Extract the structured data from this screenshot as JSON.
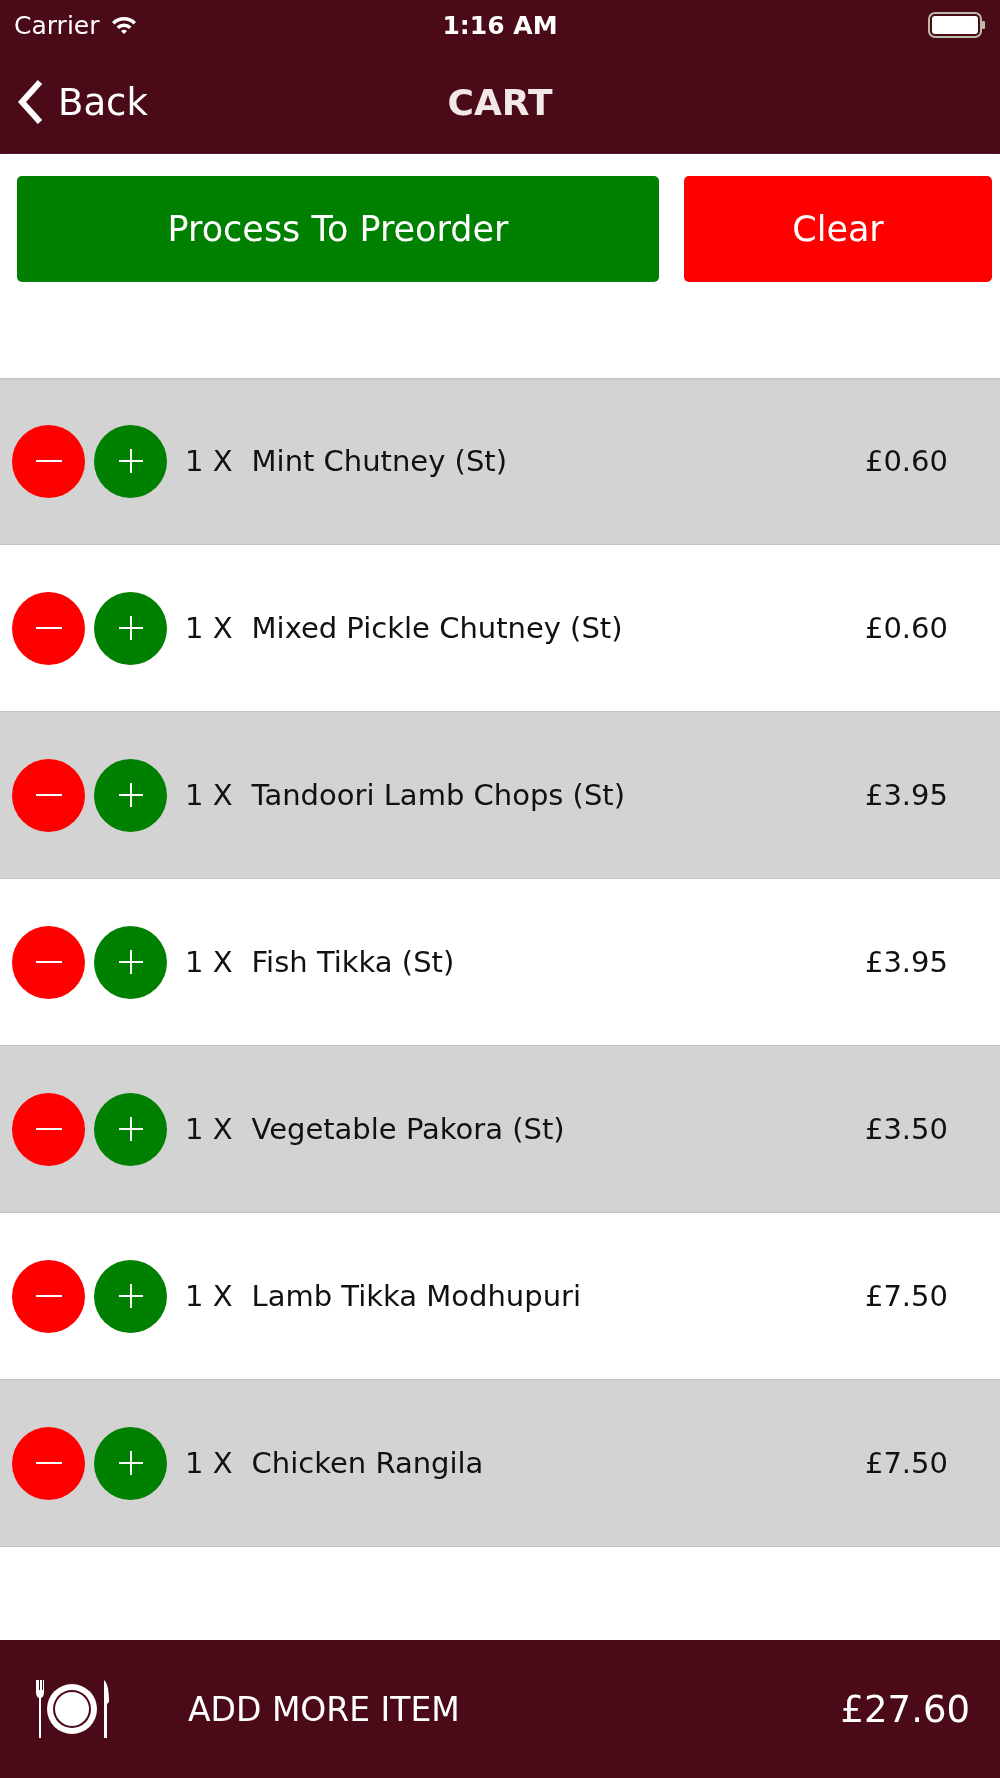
{
  "status_bar": {
    "carrier": "Carrier",
    "time": "1:16 AM"
  },
  "nav": {
    "back": "Back",
    "title": "CART"
  },
  "actions": {
    "primary": "Process To Preorder",
    "clear": "Clear"
  },
  "cart_items": [
    {
      "quantity": "1 X",
      "name": "Mint Chutney (St)",
      "price": "£0.60"
    },
    {
      "quantity": "1 X",
      "name": "Mixed Pickle Chutney (St)",
      "price": "£0.60"
    },
    {
      "quantity": "1 X",
      "name": "Tandoori Lamb Chops (St)",
      "price": "£3.95"
    },
    {
      "quantity": "1 X",
      "name": "Fish Tikka (St)",
      "price": "£3.95"
    },
    {
      "quantity": "1 X",
      "name": "Vegetable Pakora (St)",
      "price": "£3.50"
    },
    {
      "quantity": "1 X",
      "name": "Lamb Tikka Modhupuri",
      "price": "£7.50"
    },
    {
      "quantity": "1 X",
      "name": "Chicken Rangila",
      "price": "£7.50"
    }
  ],
  "bottom_bar": {
    "label": "ADD MORE ITEM",
    "total": "£27.60"
  }
}
